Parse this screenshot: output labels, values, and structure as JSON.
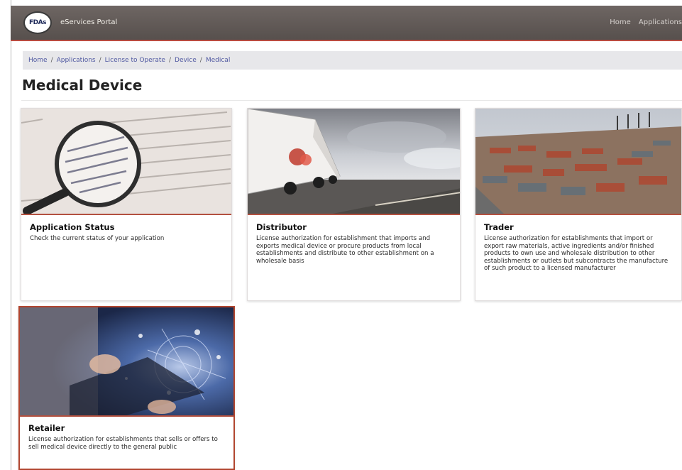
{
  "header": {
    "logo_text": "FDAs",
    "brand": "eServices Portal",
    "nav_links": [
      "Home",
      "Applications"
    ]
  },
  "breadcrumb": [
    "Home",
    "Applications",
    "License to Operate",
    "Device",
    "Medical"
  ],
  "page_title": "Medical Device",
  "cards": [
    {
      "title": "Application Status",
      "description": "Check the current status of your application",
      "image_subject": "magnifying-glass-over-document"
    },
    {
      "title": "Distributor",
      "description": "License authorization for establishment that imports and exports medical device or procure products from local establishments and distribute to other establishment on a wholesale basis",
      "image_subject": "truck-on-highway"
    },
    {
      "title": "Trader",
      "description": "License authorization for establishments that import or export raw materials, active ingredients and/or finished products to own use and wholesale distribution to other establishments or outlets but subcontracts the manufacture of such product to a licensed manufacturer",
      "image_subject": "shipping-port"
    },
    {
      "title": "Retailer",
      "description": "License authorization for establishments that sells or offers to sell medical device directly to the general public",
      "image_subject": "hands-on-tablet-digital"
    }
  ],
  "colors": {
    "navbar": "#5e5754",
    "accent": "#b84a3e",
    "breadcrumb_bg": "#e7e7ea",
    "breadcrumb_link": "#4e57a0"
  }
}
